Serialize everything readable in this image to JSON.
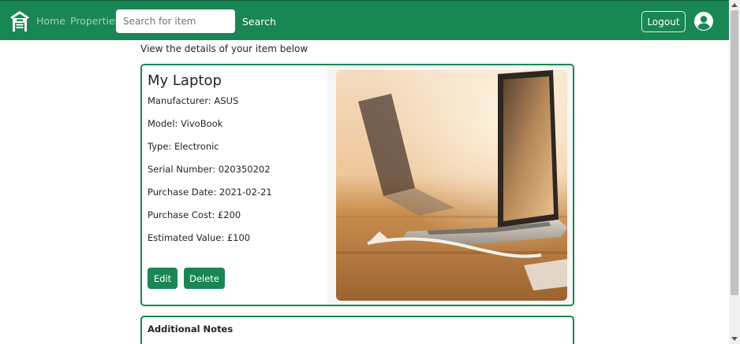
{
  "navbar": {
    "logo_icon": "house-icon",
    "links": [
      "Home",
      "Properties"
    ],
    "search": {
      "placeholder": "Search for item",
      "value": ""
    },
    "search_label": "Search",
    "logout_label": "Logout",
    "avatar_icon": "user-avatar-icon",
    "background_color": "#198754"
  },
  "main": {
    "intro_text": "View the details of your item below",
    "item": {
      "name": "My Laptop",
      "details": [
        "Manufacturer: ASUS",
        "Model: VivoBook",
        "Type: Electronic",
        "Serial Number: 020350202",
        "Purchase Date: 2021-02-21",
        "Purchase Cost: £200",
        "Estimated Value: £100"
      ],
      "edit_label": "Edit",
      "delete_label": "Delete",
      "image_subject": "laptop-photo"
    },
    "notes": {
      "title": "Additional Notes"
    }
  },
  "colors": {
    "accent": "#198754",
    "text": "#212529"
  }
}
